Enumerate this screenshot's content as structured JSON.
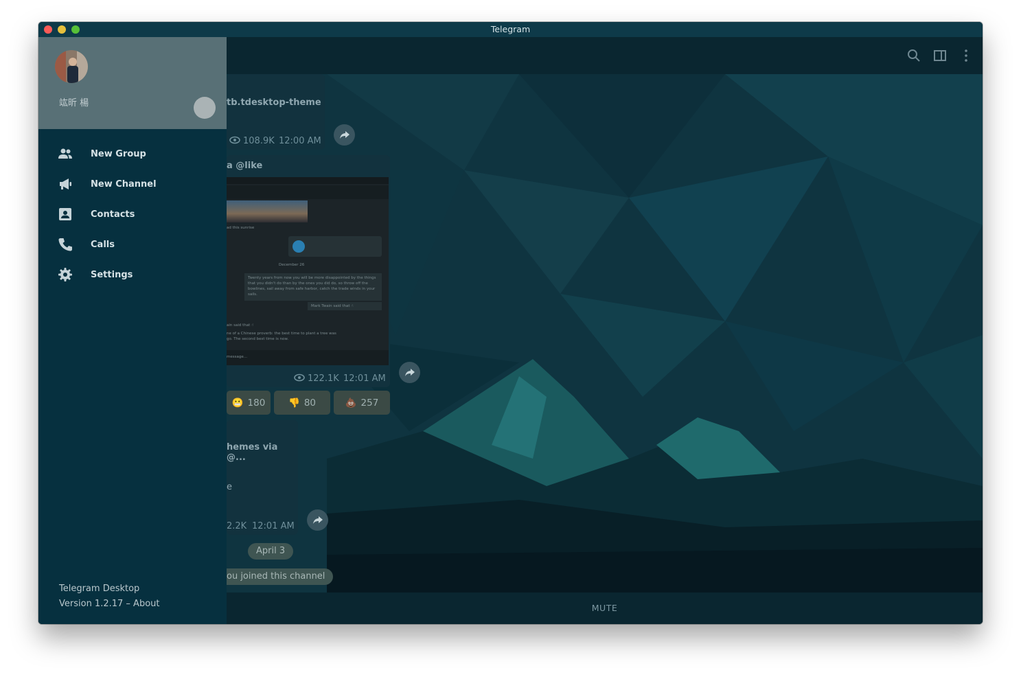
{
  "window": {
    "title": "Telegram"
  },
  "drawer": {
    "username": "竑昕 楊",
    "menu": [
      {
        "label": "New Group",
        "icon": "group-icon"
      },
      {
        "label": "New Channel",
        "icon": "megaphone-icon"
      },
      {
        "label": "Contacts",
        "icon": "contact-card-icon"
      },
      {
        "label": "Calls",
        "icon": "phone-icon"
      },
      {
        "label": "Settings",
        "icon": "gear-icon"
      }
    ],
    "footer": {
      "app_name": "Telegram Desktop",
      "version": "Version 1.2.17 – About"
    }
  },
  "chat": {
    "messages": [
      {
        "text": "tb.tdesktop-theme",
        "views": "108.9K",
        "time": "12:00 AM"
      },
      {
        "text": "a @like",
        "views": "122.1K",
        "time": "12:01 AM"
      },
      {
        "text": "hemes via @...",
        "subtext": "e",
        "views": "2.2K",
        "time": "12:01 AM"
      }
    ],
    "reactions": [
      {
        "emoji": "😬",
        "count": "180"
      },
      {
        "emoji": "👎",
        "count": "80"
      },
      {
        "emoji": "💩",
        "count": "257"
      }
    ],
    "date_pill": "April 3",
    "service_message": "ou joined this channel",
    "mute_button": "MUTE"
  },
  "embedded_screenshot": {
    "caption_1": "ad this sunrise",
    "date": "December 26",
    "quote": "Twenty years from now you will be more disappointed by the things that you didn't do than by the ones you did do, so throw off the bowlines, sail away from safe harbor, catch the trade winds in your sails.",
    "reply": "Mark Twain said that ☝",
    "reply_time": "9:00",
    "forward_1": "ain said that ☝",
    "forward_2": "ne of a Chinese proverb: the best time to plant a tree was",
    "forward_3": "go. The second best time is now.",
    "input_placeholder": "message..."
  },
  "colors": {
    "drawer_bg": "#06303f",
    "drawer_header": "#587076",
    "titlebar": "#0e3a49",
    "accent": "#2a9fd6"
  }
}
